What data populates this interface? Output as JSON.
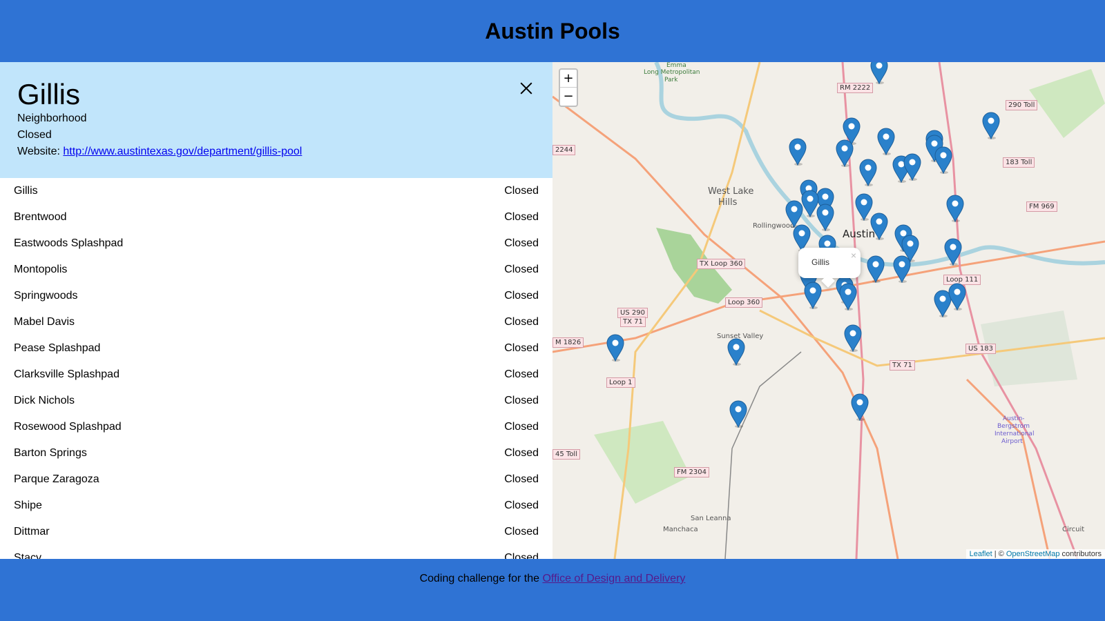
{
  "header": {
    "title": "Austin Pools"
  },
  "detail": {
    "name": "Gillis",
    "type": "Neighborhood",
    "status": "Closed",
    "website_label": "Website:",
    "website_url": "http://www.austintexas.gov/department/gillis-pool"
  },
  "pools": [
    {
      "name": "Gillis",
      "status": "Closed"
    },
    {
      "name": "Brentwood",
      "status": "Closed"
    },
    {
      "name": "Eastwoods Splashpad",
      "status": "Closed"
    },
    {
      "name": "Montopolis",
      "status": "Closed"
    },
    {
      "name": "Springwoods",
      "status": "Closed"
    },
    {
      "name": "Mabel Davis",
      "status": "Closed"
    },
    {
      "name": "Pease Splashpad",
      "status": "Closed"
    },
    {
      "name": "Clarksville Splashpad",
      "status": "Closed"
    },
    {
      "name": "Dick Nichols",
      "status": "Closed"
    },
    {
      "name": "Rosewood Splashpad",
      "status": "Closed"
    },
    {
      "name": "Barton Springs",
      "status": "Closed"
    },
    {
      "name": "Parque Zaragoza",
      "status": "Closed"
    },
    {
      "name": "Shipe",
      "status": "Closed"
    },
    {
      "name": "Dittmar",
      "status": "Closed"
    },
    {
      "name": "Stacy",
      "status": "Closed"
    }
  ],
  "map": {
    "zoom_in": "+",
    "zoom_out": "−",
    "popup_text": "Gillis",
    "popup_close": "×",
    "attribution_leaflet": "Leaflet",
    "attribution_sep": " | © ",
    "attribution_osm": "OpenStreetMap",
    "attribution_rest": " contributors",
    "labels": {
      "city": "Austin",
      "west_lake": "West Lake",
      "hills": "Hills",
      "rollingwood": "Rollingwood",
      "sunset_valley": "Sunset Valley",
      "san_leanna": "San Leanna",
      "manchaca": "Manchaca",
      "circuit": "Circuit",
      "airport1": "Austin-",
      "airport2": "Bergstrom",
      "airport3": "International",
      "airport4": "Airport",
      "emma1": "Emma",
      "emma2": "Long Metropolitan",
      "emma3": "Park"
    },
    "shields": {
      "rm2222": "RM 2222",
      "toll290": "290 Toll",
      "toll183": "183 Toll",
      "fm969": "FM 969",
      "loop360a": "TX Loop 360",
      "loop360b": "Loop 360",
      "us290a": "US 290",
      "tx71a": "TX 71",
      "loop111": "Loop 111",
      "m1826": "M 1826",
      "loop1": "Loop 1",
      "tx71b": "TX 71",
      "us183": "US 183",
      "toll45": "45 Toll",
      "fm2304": "FM 2304",
      "r2244": "2244"
    },
    "colors": {
      "marker": "#2a81cb",
      "park": "#c8e6b0",
      "road": "#f5a27a",
      "water": "#aad3df"
    }
  },
  "footer": {
    "text": "Coding challenge for the ",
    "link": "Office of Design and Delivery"
  }
}
